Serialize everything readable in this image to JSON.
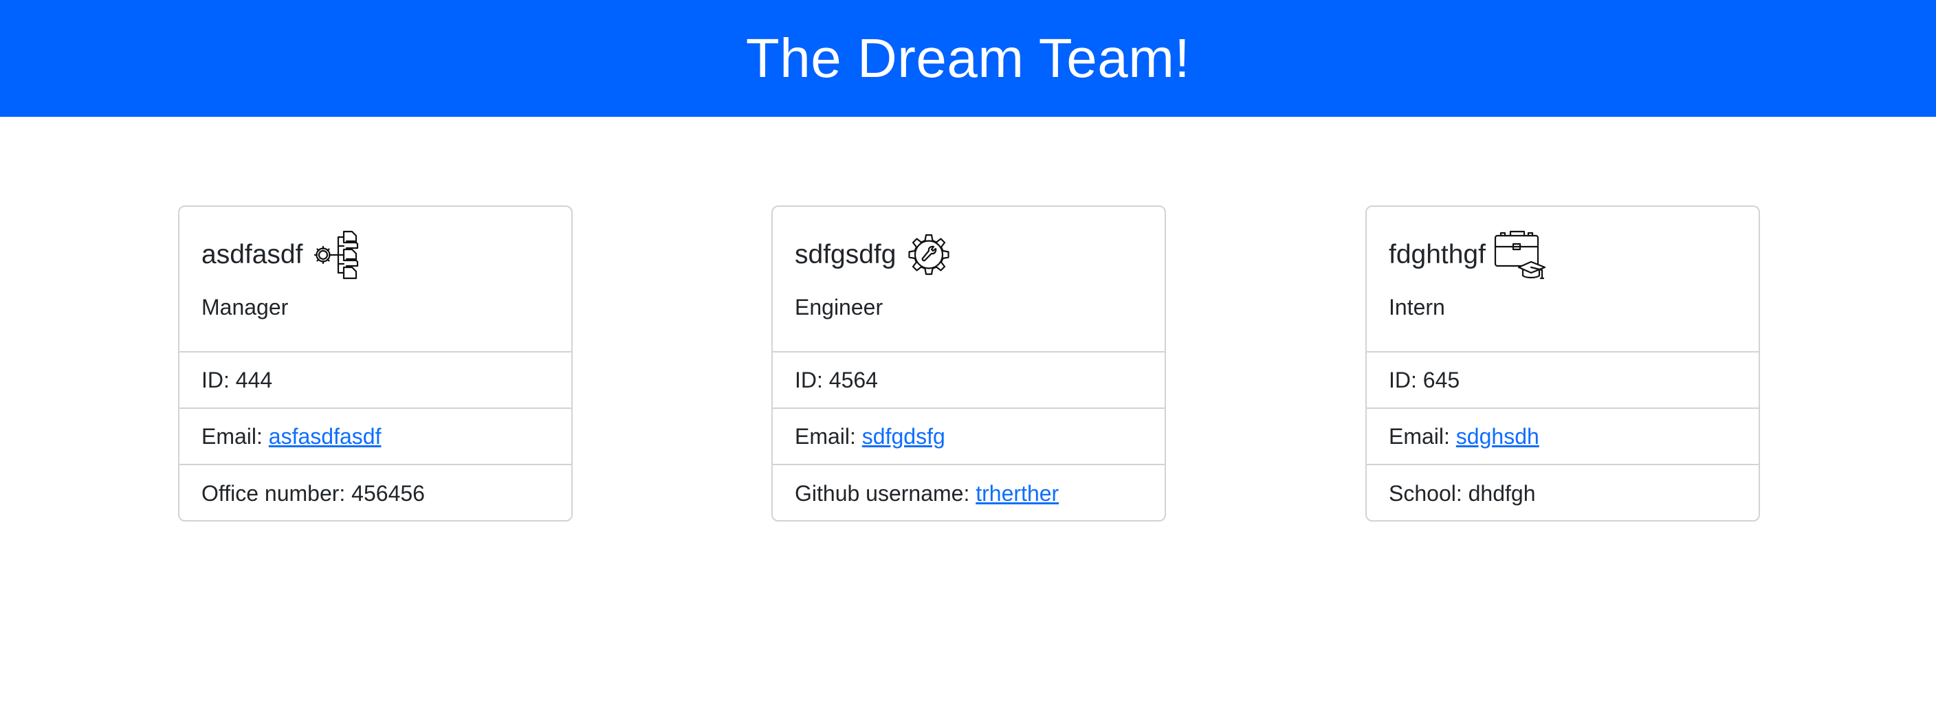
{
  "header": {
    "title": "The Dream Team!"
  },
  "colors": {
    "banner": "#0062ff",
    "link": "#0d6efd",
    "border": "#d3d3d3"
  },
  "cards": [
    {
      "name": "asdfasdf",
      "role": "Manager",
      "icon": "org-chart-gear-icon",
      "id_label": "ID: 444",
      "email_prefix": "Email: ",
      "email": "asfasdfasdf",
      "extra_prefix": "Office number: 456456"
    },
    {
      "name": "sdfgsdfg",
      "role": "Engineer",
      "icon": "gear-wrench-icon",
      "id_label": "ID: 4564",
      "email_prefix": "Email: ",
      "email": "sdfgdsfg",
      "extra_prefix": "Github username: ",
      "extra_link": "trherther"
    },
    {
      "name": "fdghthgf",
      "role": "Intern",
      "icon": "briefcase-graduation-cap-icon",
      "id_label": "ID: 645",
      "email_prefix": "Email: ",
      "email": "sdghsdh",
      "extra_prefix": "School: dhdfgh"
    }
  ]
}
